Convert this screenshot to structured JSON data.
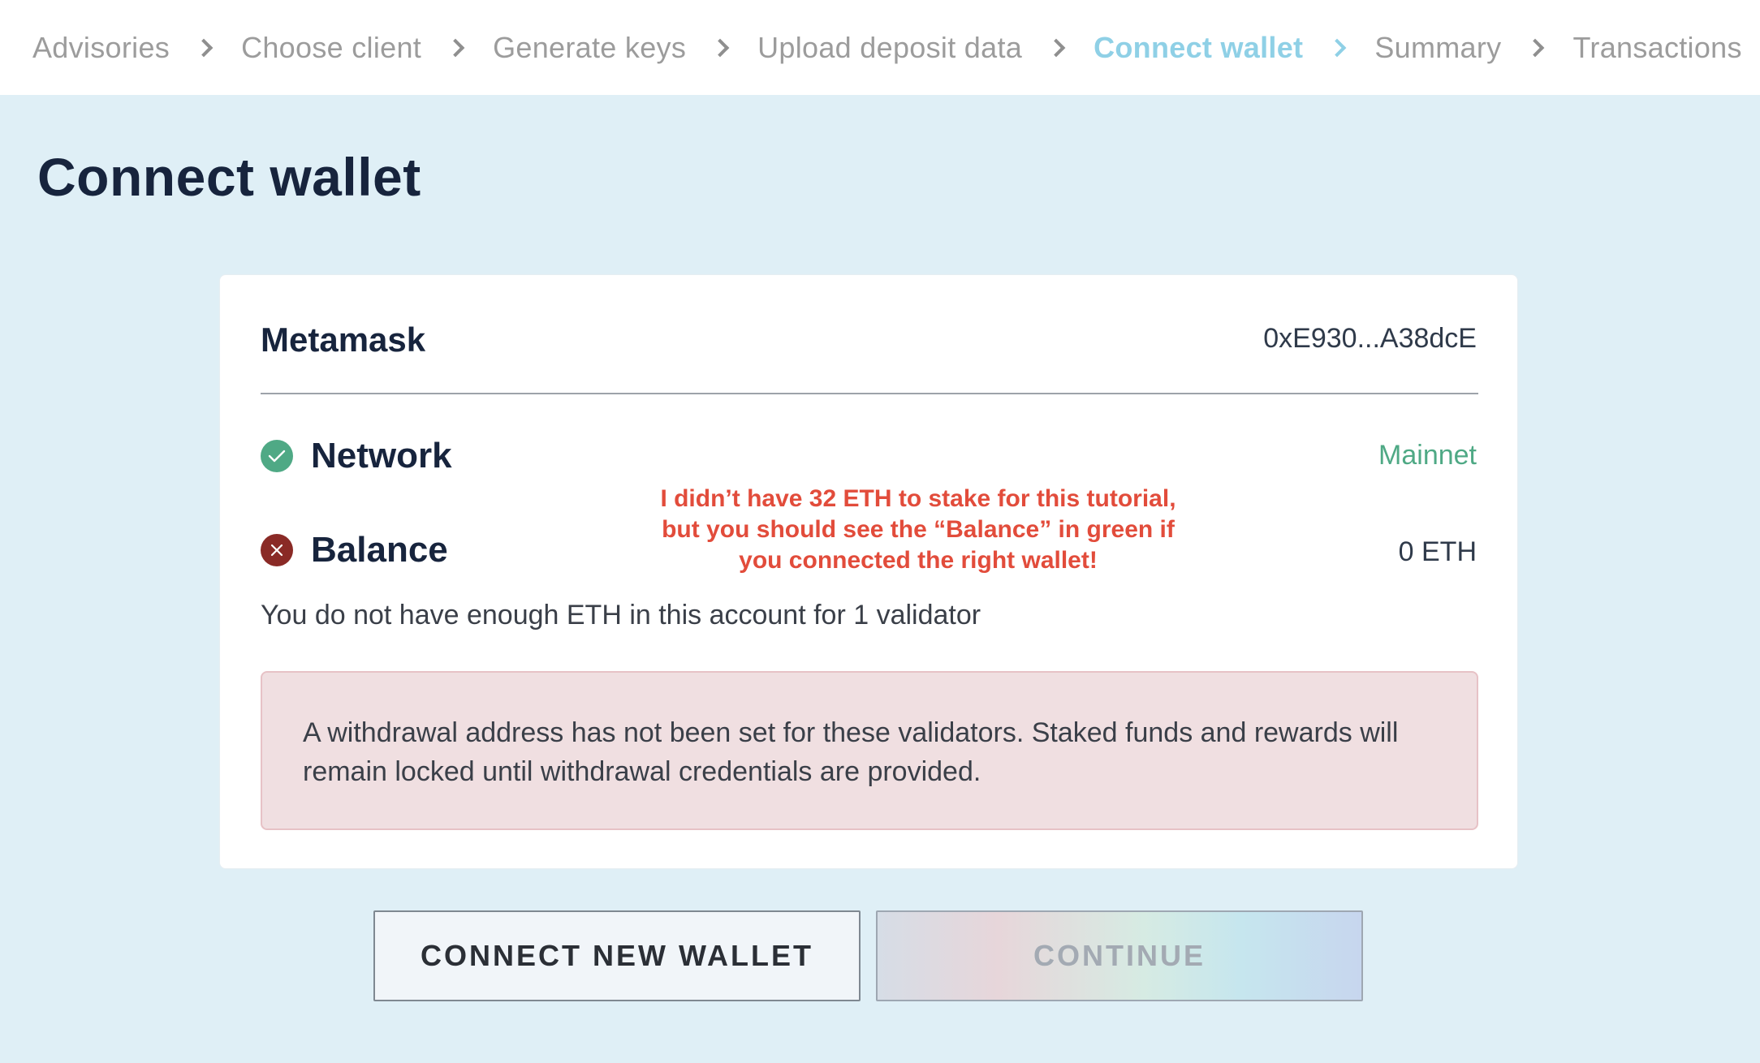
{
  "stepper": {
    "steps": [
      {
        "label": "Advisories",
        "active": false
      },
      {
        "label": "Choose client",
        "active": false
      },
      {
        "label": "Generate keys",
        "active": false
      },
      {
        "label": "Upload deposit data",
        "active": false
      },
      {
        "label": "Connect wallet",
        "active": true
      },
      {
        "label": "Summary",
        "active": false
      },
      {
        "label": "Transactions",
        "active": false
      }
    ]
  },
  "page": {
    "title": "Connect wallet"
  },
  "wallet": {
    "name": "Metamask",
    "address": "0xE930...A38dcE"
  },
  "network": {
    "label": "Network",
    "value": "Mainnet",
    "status": "ok"
  },
  "balance": {
    "label": "Balance",
    "value": "0 ETH",
    "status": "error",
    "message": "You do not have enough ETH in this account for 1 validator"
  },
  "annotation": {
    "line1": "I didn’t have 32 ETH to stake for this tutorial,",
    "line2": "but you should see the “Balance” in green if",
    "line3": "you connected the right wallet!"
  },
  "alert": {
    "text": "A withdrawal address has not been set for these validators. Staked funds and rewards will remain locked until withdrawal credentials are provided."
  },
  "buttons": {
    "connect_new_wallet": "CONNECT NEW WALLET",
    "continue": "CONTINUE"
  },
  "colors": {
    "background": "#dfeff6",
    "active_step": "#8fd0e6",
    "success": "#4fa985",
    "error": "#8a2a26",
    "annotation": "#e24c3b",
    "alert_bg": "#f0dfe1"
  }
}
